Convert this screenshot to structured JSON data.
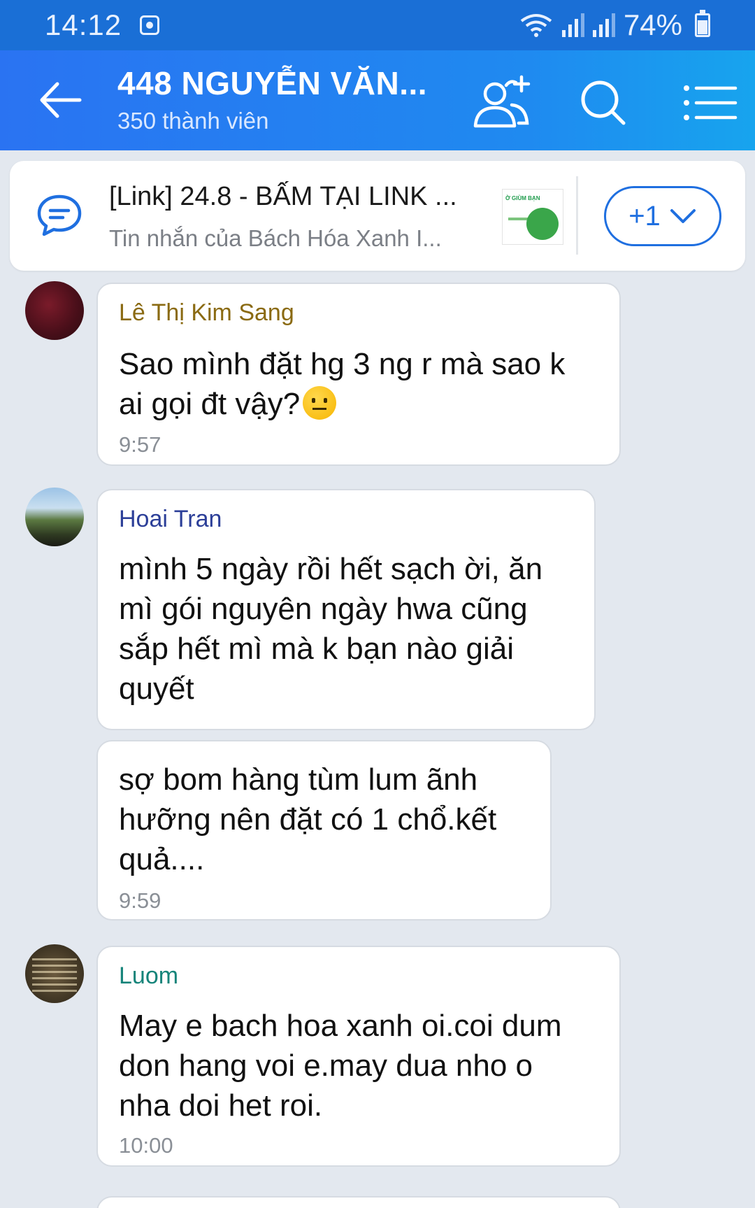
{
  "status_bar": {
    "time": "14:12",
    "battery": "74%"
  },
  "header": {
    "title": "448 NGUYỄN VĂN...",
    "subtitle": "350 thành viên",
    "icons": [
      "back-arrow-icon",
      "add-member-icon",
      "search-icon",
      "menu-icon"
    ]
  },
  "pinned": {
    "title": "[Link] 24.8 - BẤM TẠI LINK ...",
    "subtitle": "Tin nhắn của Bách Hóa Xanh I...",
    "thumbnail_text": "Ờ GIÙM BẠN",
    "more_label": "+1"
  },
  "messages": [
    {
      "sender": "Lê Thị Kim Sang",
      "lines": [
        "Sao mình đặt hg 3 ng r mà sao k",
        "ai gọi đt vậy?"
      ],
      "time": "9:57"
    },
    {
      "sender": "Hoai Tran",
      "lines": [
        "mình 5 ngày rồi hết sạch ời, ăn",
        "mì gói nguyên ngày hwa cũng",
        "sắp hết mì mà k bạn nào giải",
        "quyết"
      ]
    },
    {
      "lines": [
        "sợ bom hàng tùm lum ãnh",
        "hưỡng nên đặt có 1 chổ.kết",
        "quả...."
      ],
      "time": "9:59"
    },
    {
      "sender": "Luom",
      "lines": [
        "May e bach hoa xanh oi.coi dum",
        "don hang voi e.may dua nho o",
        "nha doi het roi."
      ],
      "time": "10:00"
    }
  ],
  "colors": {
    "header": "#2a73f2",
    "accent": "#1f6fe0",
    "chat_bg": "#e3e8ef"
  }
}
